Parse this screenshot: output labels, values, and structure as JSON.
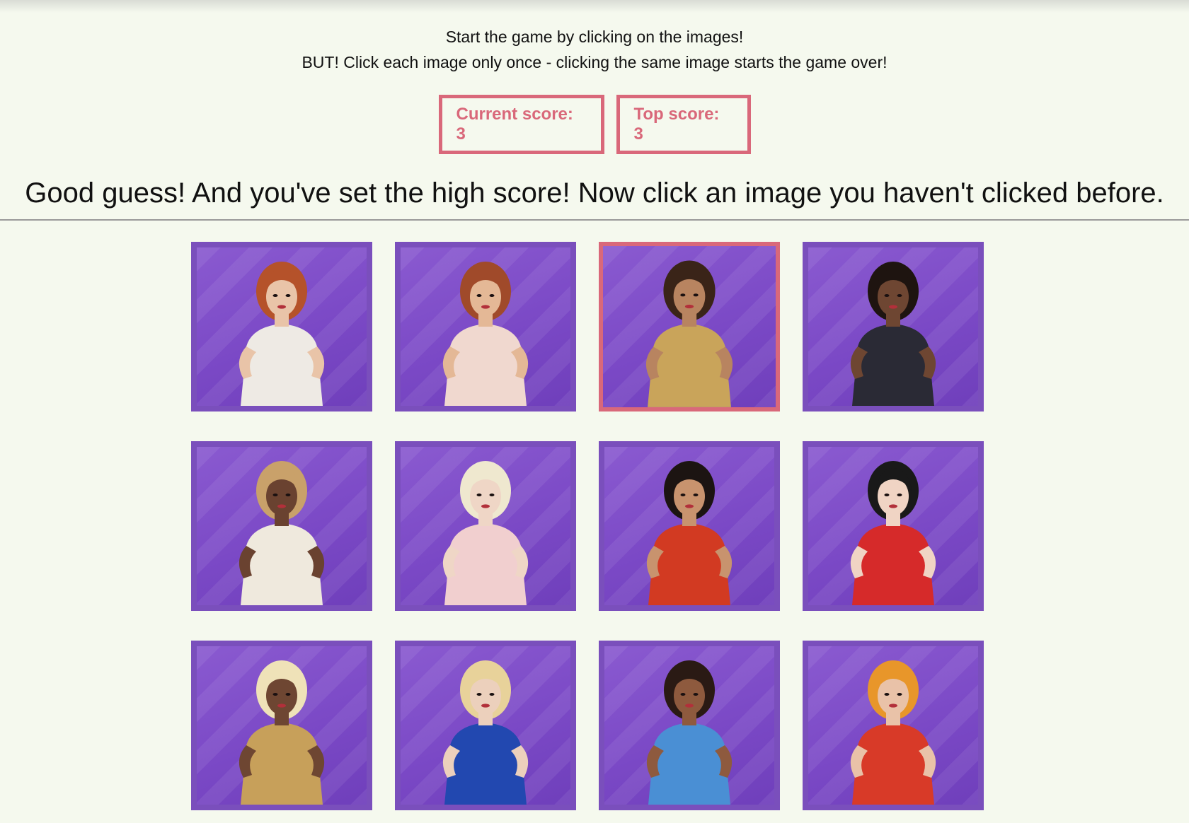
{
  "instructions": {
    "line1": "Start the game by clicking on the images!",
    "line2": "BUT! Click each image only once - clicking the same image starts the game over!"
  },
  "scores": {
    "current_label": "Current score: 3",
    "top_label": "Top score: 3"
  },
  "message": "Good guess! And you've set the high score! Now click an image you haven't clicked before.",
  "colors": {
    "background": "#f5f9ee",
    "accent": "#d9687a",
    "card_border": "#7a4fbc",
    "card_bg": "#7b49c6"
  },
  "cards": [
    {
      "hair": "#b5522a",
      "outfit": "#eeeae4",
      "skin": "#e9c4a8",
      "selected": false
    },
    {
      "hair": "#a04a2a",
      "outfit": "#f0d8cf",
      "skin": "#e4b896",
      "selected": false
    },
    {
      "hair": "#3a2418",
      "outfit": "#c9a45a",
      "skin": "#b88460",
      "selected": true
    },
    {
      "hair": "#1e1410",
      "outfit": "#2a2a35",
      "skin": "#6e4632",
      "selected": false
    },
    {
      "hair": "#c9a16a",
      "outfit": "#efe9dd",
      "skin": "#6a4230",
      "selected": false
    },
    {
      "hair": "#efe8cf",
      "outfit": "#f1cfcf",
      "skin": "#efd6c6",
      "selected": false
    },
    {
      "hair": "#1c1412",
      "outfit": "#d23a22",
      "skin": "#c8936e",
      "selected": false
    },
    {
      "hair": "#191919",
      "outfit": "#d62a2a",
      "skin": "#f0d4c4",
      "selected": false
    },
    {
      "hair": "#efe2b8",
      "outfit": "#c7a05a",
      "skin": "#6e4632",
      "selected": false
    },
    {
      "hair": "#e8d29a",
      "outfit": "#2248b0",
      "skin": "#ecd0bc",
      "selected": false
    },
    {
      "hair": "#2a1a14",
      "outfit": "#4a8fd4",
      "skin": "#8e5a3e",
      "selected": false
    },
    {
      "hair": "#e8962a",
      "outfit": "#d83a28",
      "skin": "#e9c2a8",
      "selected": false
    }
  ]
}
